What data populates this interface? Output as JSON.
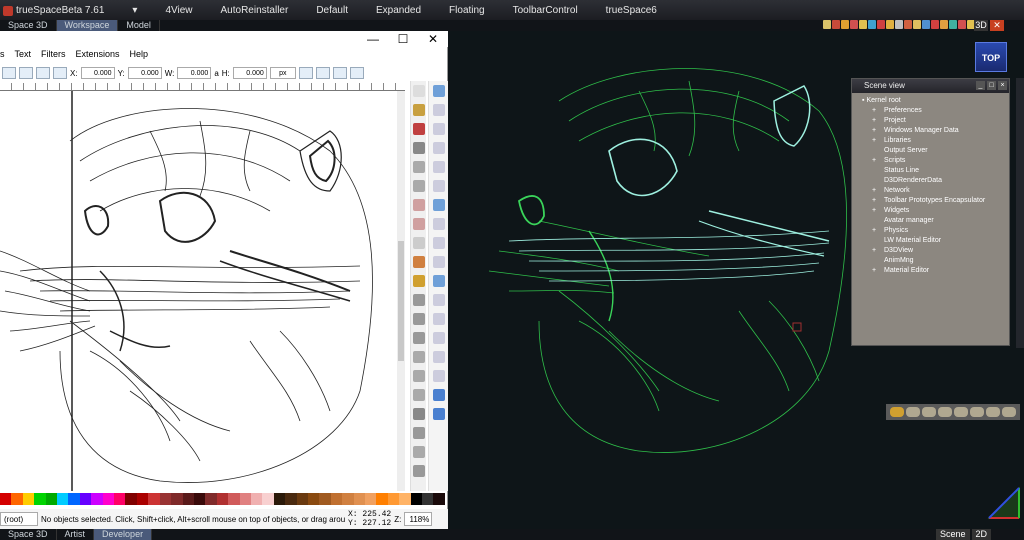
{
  "ts_top": {
    "app_title": "trueSpaceBeta 7.61",
    "tabs": [
      "4View",
      "AutoReinstaller",
      "Default",
      "Expanded",
      "Floating",
      "ToolbarControl",
      "trueSpace6"
    ]
  },
  "ts_window_tabs": {
    "items": [
      "Space 3D",
      "Workspace",
      "Model"
    ],
    "active": "Workspace"
  },
  "ts_right": {
    "mode_3d": "3D",
    "view_label": "TOP"
  },
  "inkscape": {
    "window_controls": [
      "—",
      "☐",
      "✕"
    ],
    "menu": [
      "s",
      "Text",
      "Filters",
      "Extensions",
      "Help"
    ],
    "toolbar": {
      "x_label": "X:",
      "x_value": "0.000",
      "y_label": "Y:",
      "y_value": "0.000",
      "w_label": "W:",
      "w_value": "0.000",
      "lock": "a",
      "h_label": "H:",
      "h_value": "0.000",
      "unit": "px"
    },
    "palette": [
      "#d40000",
      "#ff6600",
      "#ffcc00",
      "#00d400",
      "#00aa00",
      "#00ccff",
      "#0066ff",
      "#6600ff",
      "#cc00ff",
      "#ff00cc",
      "#ff0066",
      "#800000",
      "#aa0000",
      "#cc3333",
      "#993333",
      "#7f2a2a",
      "#5a1a1a",
      "#3a0a0a",
      "#802b2b",
      "#b03030",
      "#d05a5a",
      "#e08080",
      "#f0b0b0",
      "#f8d0d0",
      "#2b1a0a",
      "#4a2a10",
      "#6a3a10",
      "#8a4a10",
      "#a05a20",
      "#c07030",
      "#d08040",
      "#e09050",
      "#f0a060",
      "#ff7f00",
      "#ff9933",
      "#ffb366",
      "#000000",
      "#333333",
      "#1a0a0a"
    ],
    "status": {
      "layer": "(root)",
      "message": "No objects selected. Click, Shift+click, Alt+scroll mouse on top of objects, or drag around ob",
      "x_label": "X:",
      "x": "225.42",
      "y_label": "Y:",
      "y": "227.12",
      "z_label": "Z:",
      "zoom": "118%"
    }
  },
  "scene_view": {
    "title": "Scene view",
    "root": "Kernel root",
    "items": [
      {
        "label": "Preferences",
        "expandable": true
      },
      {
        "label": "Project",
        "expandable": true
      },
      {
        "label": "Windows Manager Data",
        "expandable": true
      },
      {
        "label": "Libraries",
        "expandable": true
      },
      {
        "label": "Output Server",
        "expandable": false
      },
      {
        "label": "Scripts",
        "expandable": true
      },
      {
        "label": "Status Line",
        "expandable": false
      },
      {
        "label": "D3DRendererData",
        "expandable": false
      },
      {
        "label": "Network",
        "expandable": true
      },
      {
        "label": "Toolbar Prototypes Encapsulator",
        "expandable": true
      },
      {
        "label": "Widgets",
        "expandable": true
      },
      {
        "label": "Avatar manager",
        "expandable": false
      },
      {
        "label": "Physics",
        "expandable": true
      },
      {
        "label": "LW Material Editor",
        "expandable": false
      },
      {
        "label": "D3DView",
        "expandable": true
      },
      {
        "label": "AnimMng",
        "expandable": false
      },
      {
        "label": "Material Editor",
        "expandable": true
      }
    ]
  },
  "ts_bottom": {
    "tabs": [
      "Space 3D",
      "Artist",
      "Developer"
    ],
    "active": "Developer",
    "scene": "Scene",
    "mode_2d": "2D"
  },
  "colors": {
    "ts_bg": "#1c1d22",
    "viewport": "#0e1518",
    "wire_green": "#3ad45a",
    "wire_cyan": "#9ef0e0",
    "scene_panel": "#8c8780"
  }
}
